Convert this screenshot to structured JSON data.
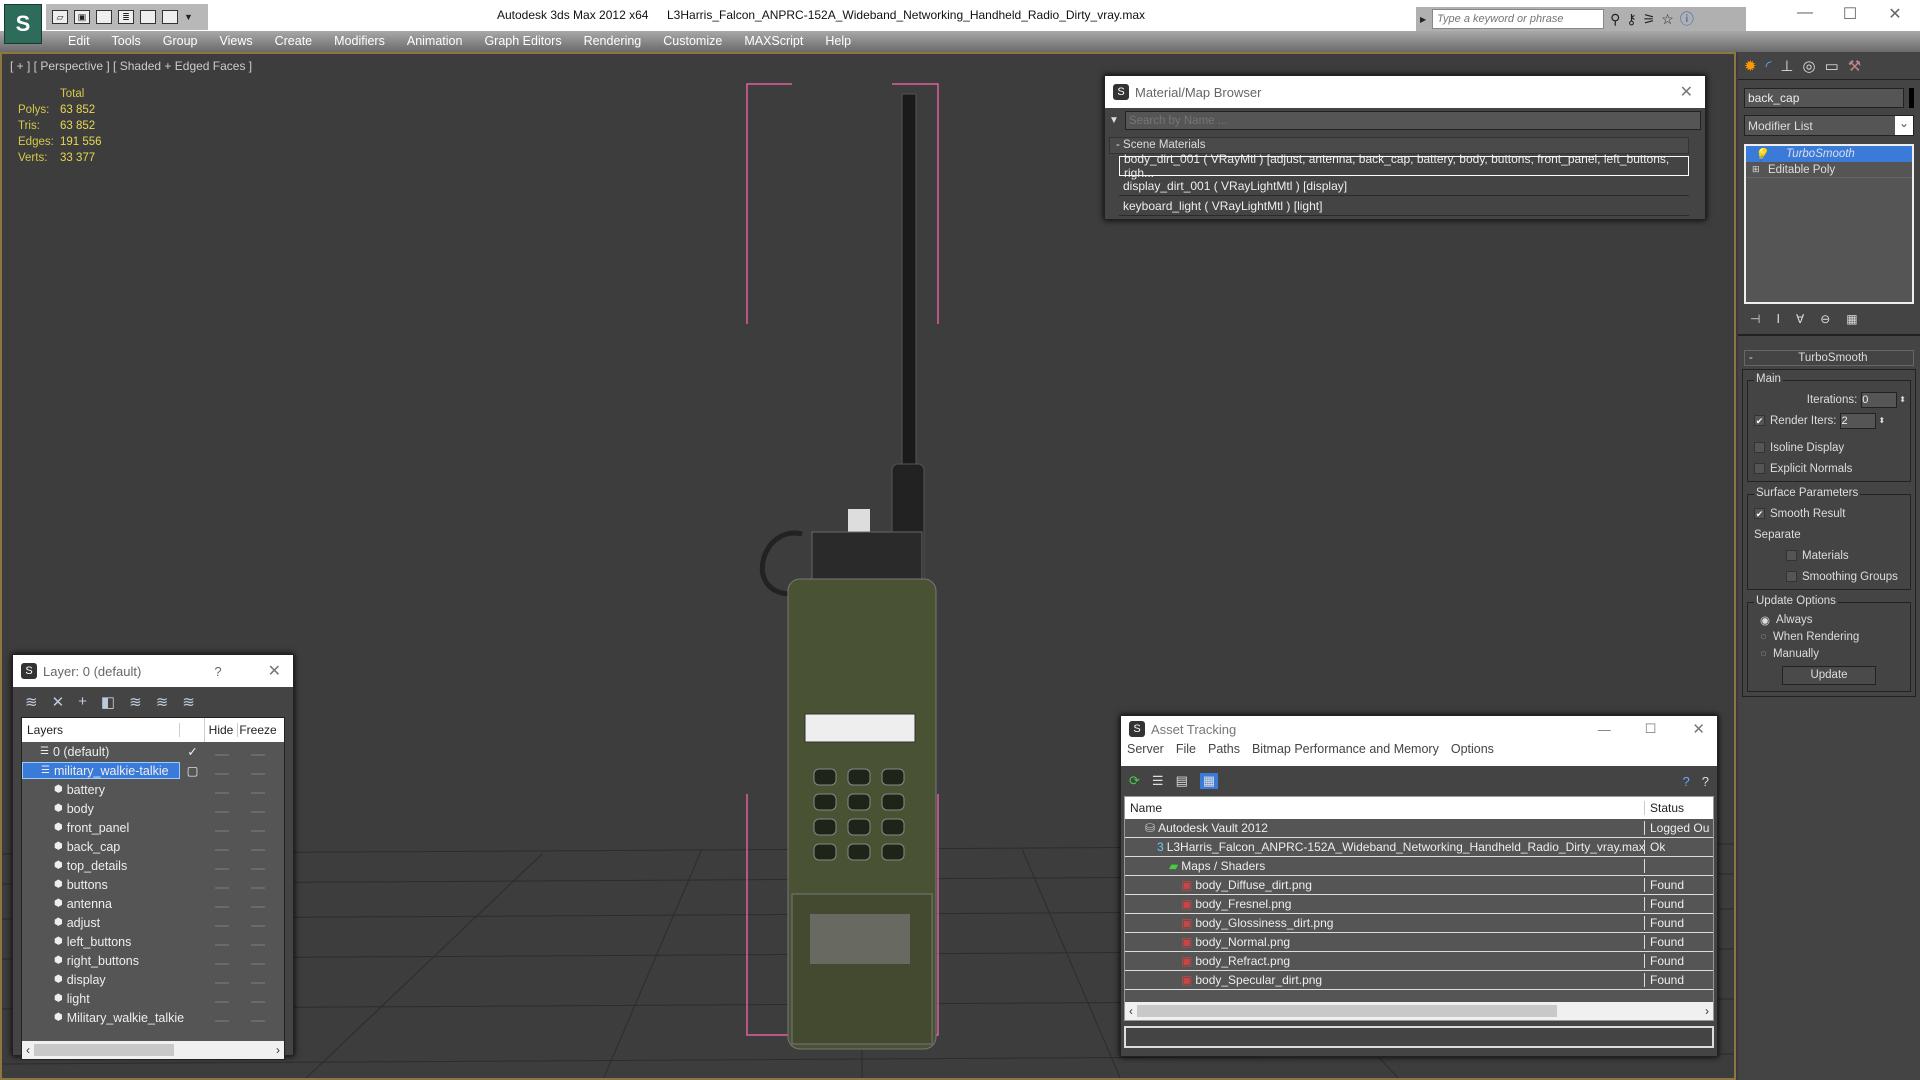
{
  "titlebar": {
    "app": "Autodesk 3ds Max  2012 x64",
    "file": "L3Harris_Falcon_ANPRC-152A_Wideband_Networking_Handheld_Radio_Dirty_vray.max",
    "search_placeholder": "Type a keyword or phrase"
  },
  "menu": [
    "Edit",
    "Tools",
    "Group",
    "Views",
    "Create",
    "Modifiers",
    "Animation",
    "Graph Editors",
    "Rendering",
    "Customize",
    "MAXScript",
    "Help"
  ],
  "viewport": {
    "label": "[ + ] [ Perspective ] [ Shaded + Edged Faces ]",
    "stats": {
      "header": "Total",
      "rows": [
        {
          "k": "Polys:",
          "v": "63 852"
        },
        {
          "k": "Tris:",
          "v": "63 852"
        },
        {
          "k": "Edges:",
          "v": "191 556"
        },
        {
          "k": "Verts:",
          "v": "33 377"
        }
      ]
    }
  },
  "material_browser": {
    "title": "Material/Map Browser",
    "search_placeholder": "Search by Name ...",
    "section": "Scene Materials",
    "items": [
      "body_dirt_001 ( VRayMtl ) [adjust, antenna, back_cap, battery, body, buttons, front_panel, left_buttons, righ...",
      "display_dirt_001 ( VRayLightMtl ) [display]",
      "keyboard_light ( VRayLightMtl ) [light]"
    ]
  },
  "layers": {
    "title": "Layer: 0 (default)",
    "help": "?",
    "columns": [
      "Layers",
      "Hide",
      "Freeze"
    ],
    "default_layer": "0 (default)",
    "active_layer": "military_walkie-talkie",
    "objects": [
      "battery",
      "body",
      "front_panel",
      "back_cap",
      "top_details",
      "buttons",
      "antenna",
      "adjust",
      "left_buttons",
      "right_buttons",
      "display",
      "light",
      "Military_walkie_talkie"
    ]
  },
  "asset_tracking": {
    "title": "Asset Tracking",
    "menu": [
      "Server",
      "File",
      "Paths",
      "Bitmap Performance and Memory",
      "Options"
    ],
    "columns": [
      "Name",
      "Status"
    ],
    "rows": [
      {
        "name": "Autodesk Vault 2012",
        "status": "Logged Ou",
        "indent": 1
      },
      {
        "name": "L3Harris_Falcon_ANPRC-152A_Wideband_Networking_Handheld_Radio_Dirty_vray.max",
        "status": "Ok",
        "indent": 2
      },
      {
        "name": "Maps / Shaders",
        "status": "",
        "indent": 3
      },
      {
        "name": "body_Diffuse_dirt.png",
        "status": "Found",
        "indent": 4
      },
      {
        "name": "body_Fresnel.png",
        "status": "Found",
        "indent": 4
      },
      {
        "name": "body_Glossiness_dirt.png",
        "status": "Found",
        "indent": 4
      },
      {
        "name": "body_Normal.png",
        "status": "Found",
        "indent": 4
      },
      {
        "name": "body_Refract.png",
        "status": "Found",
        "indent": 4
      },
      {
        "name": "body_Specular_dirt.png",
        "status": "Found",
        "indent": 4
      }
    ]
  },
  "command_panel": {
    "object_name": "back_cap",
    "modifier_list": "Modifier List",
    "stack": [
      "TurboSmooth",
      "Editable Poly"
    ],
    "rollout": "TurboSmooth",
    "main": "Main",
    "iterations_label": "Iterations:",
    "iterations": "0",
    "render_iters_label": "Render Iters:",
    "render_iters": "2",
    "isoline": "Isoline Display",
    "explicit_normals": "Explicit Normals",
    "surface": "Surface Parameters",
    "smooth_result": "Smooth Result",
    "separate": "Separate",
    "materials": "Materials",
    "smoothing_groups": "Smoothing Groups",
    "update_options": "Update Options",
    "always": "Always",
    "when_rendering": "When Rendering",
    "manually": "Manually",
    "update_button": "Update"
  },
  "colors": {
    "selection": "#3a7ad8",
    "stats": "#e0d050",
    "viewport_border": "#8a7840",
    "bracket": "#e060a0"
  }
}
